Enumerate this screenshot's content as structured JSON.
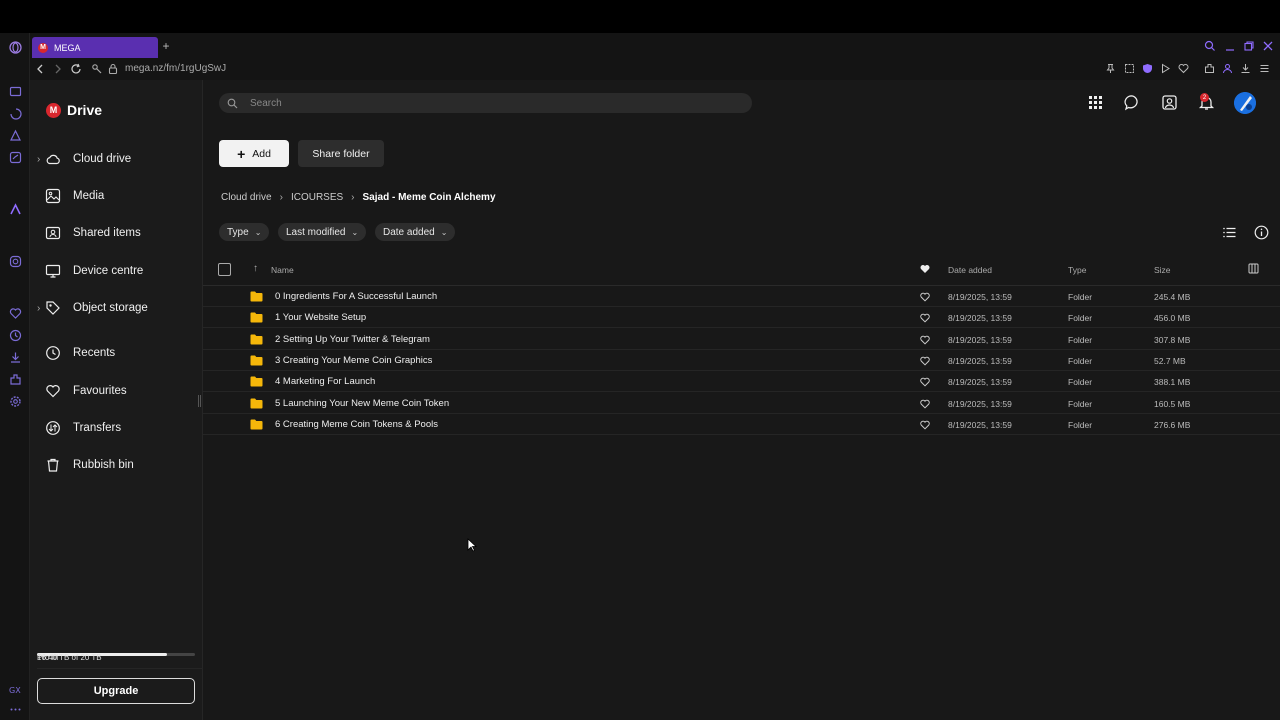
{
  "browser": {
    "tab_title": "MEGA",
    "url": "mega.nz/fm/1rgUgSwJ"
  },
  "sidebar": {
    "app_title": "Drive",
    "logo_letter": "M",
    "items": [
      {
        "label": "Cloud drive",
        "icon": "cloud-icon"
      },
      {
        "label": "Media",
        "icon": "image-icon"
      },
      {
        "label": "Shared items",
        "icon": "shared-folder-icon"
      },
      {
        "label": "Device centre",
        "icon": "monitor-icon"
      },
      {
        "label": "Object storage",
        "icon": "tag-icon"
      },
      {
        "label": "Recents",
        "icon": "clock-icon"
      },
      {
        "label": "Favourites",
        "icon": "heart-icon"
      },
      {
        "label": "Transfers",
        "icon": "transfer-icon"
      },
      {
        "label": "Rubbish bin",
        "icon": "trash-icon"
      }
    ],
    "storage": {
      "plan": "Pro III",
      "usage": "16.40 TB of 20 TB",
      "used_fraction": 0.82
    },
    "upgrade_label": "Upgrade"
  },
  "header": {
    "search_placeholder": "Search",
    "notification_count": "2",
    "accent_color": "#5a2fb0",
    "brand_color": "#d9272e"
  },
  "toolbar": {
    "add_label": "Add",
    "share_label": "Share folder"
  },
  "breadcrumb": [
    "Cloud drive",
    "ICOURSES",
    "Sajad - Meme Coin Alchemy"
  ],
  "filters": [
    "Type",
    "Last modified",
    "Date added"
  ],
  "table": {
    "columns": {
      "name": "Name",
      "date_added": "Date added",
      "type": "Type",
      "size": "Size"
    },
    "rows": [
      {
        "name": "0 Ingredients For A Successful Launch",
        "date": "8/19/2025, 13:59",
        "type": "Folder",
        "size": "245.4 MB"
      },
      {
        "name": "1 Your Website Setup",
        "date": "8/19/2025, 13:59",
        "type": "Folder",
        "size": "456.0 MB"
      },
      {
        "name": "2 Setting Up Your Twitter & Telegram",
        "date": "8/19/2025, 13:59",
        "type": "Folder",
        "size": "307.8 MB"
      },
      {
        "name": "3 Creating Your Meme Coin Graphics",
        "date": "8/19/2025, 13:59",
        "type": "Folder",
        "size": "52.7 MB"
      },
      {
        "name": "4 Marketing For Launch",
        "date": "8/19/2025, 13:59",
        "type": "Folder",
        "size": "388.1 MB"
      },
      {
        "name": "5 Launching Your New Meme Coin Token",
        "date": "8/19/2025, 13:59",
        "type": "Folder",
        "size": "160.5 MB"
      },
      {
        "name": "6 Creating Meme Coin Tokens & Pools",
        "date": "8/19/2025, 13:59",
        "type": "Folder",
        "size": "276.6 MB"
      }
    ]
  }
}
